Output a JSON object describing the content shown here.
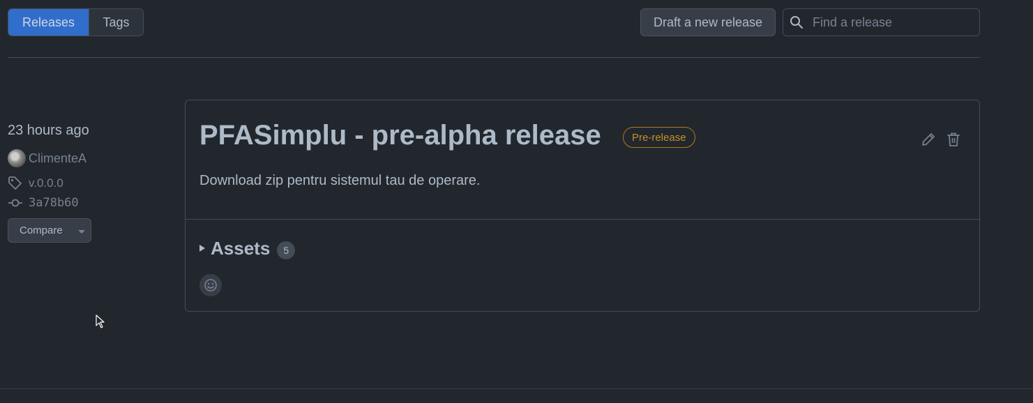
{
  "toolbar": {
    "tabs": [
      {
        "label": "Releases",
        "active": true
      },
      {
        "label": "Tags",
        "active": false
      }
    ],
    "draft_button": "Draft a new release",
    "search_placeholder": "Find a release"
  },
  "release": {
    "time": "23 hours ago",
    "author": "ClimenteA",
    "tag": "v.0.0.0",
    "commit": "3a78b60",
    "compare_label": "Compare",
    "title": "PFASimplu - pre-alpha release",
    "badge": "Pre-release",
    "body": "Download zip pentru sistemul tau de operare.",
    "assets_label": "Assets",
    "assets_count": "5"
  },
  "icons": {
    "search": "search-icon",
    "tag": "tag-icon",
    "commit": "git-commit-icon",
    "edit": "pencil-icon",
    "delete": "trash-icon",
    "reaction": "smiley-icon"
  },
  "colors": {
    "background": "#22272e",
    "accent": "#316dca",
    "prerelease": "#c69026",
    "border": "#444c56"
  }
}
